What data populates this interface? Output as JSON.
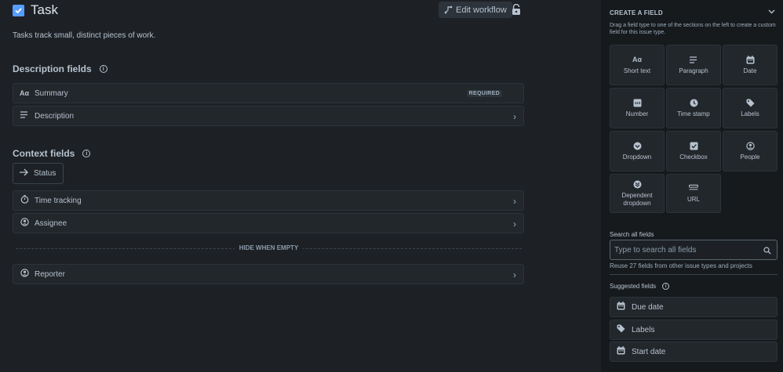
{
  "header": {
    "title": "Task",
    "edit_workflow_label": "Edit workflow",
    "description": "Tasks track small, distinct pieces of work."
  },
  "description_fields": {
    "heading": "Description fields",
    "items": [
      {
        "label": "Summary",
        "icon": "short-text-icon",
        "badge": "REQUIRED"
      },
      {
        "label": "Description",
        "icon": "paragraph-icon"
      }
    ]
  },
  "context_fields": {
    "heading": "Context fields",
    "status_label": "Status",
    "items": [
      {
        "label": "Time tracking",
        "icon": "stopwatch-icon"
      },
      {
        "label": "Assignee",
        "icon": "person-icon"
      }
    ],
    "hide_when_empty_label": "HIDE WHEN EMPTY",
    "hidden_items": [
      {
        "label": "Reporter",
        "icon": "person-icon"
      }
    ]
  },
  "sidebar": {
    "heading": "CREATE A FIELD",
    "description": "Drag a field type to one of the sections on the left to create a custom field for this issue type.",
    "field_types": [
      {
        "label": "Short text",
        "icon": "short-text-icon"
      },
      {
        "label": "Paragraph",
        "icon": "paragraph-icon"
      },
      {
        "label": "Date",
        "icon": "calendar-icon"
      },
      {
        "label": "Number",
        "icon": "number-icon"
      },
      {
        "label": "Time stamp",
        "icon": "clock-icon"
      },
      {
        "label": "Labels",
        "icon": "tag-icon"
      },
      {
        "label": "Dropdown",
        "icon": "dropdown-icon"
      },
      {
        "label": "Checkbox",
        "icon": "checkbox-icon"
      },
      {
        "label": "People",
        "icon": "person-icon"
      },
      {
        "label": "Dependent\ndropdown",
        "icon": "dependent-dropdown-icon"
      },
      {
        "label": "URL",
        "icon": "link-icon"
      }
    ],
    "search": {
      "label": "Search all fields",
      "placeholder": "Type to search all fields",
      "value": "",
      "hint": "Reuse 27 fields from other issue types and projects"
    },
    "suggested_heading": "Suggested fields",
    "suggested": [
      {
        "label": "Due date",
        "icon": "calendar-icon"
      },
      {
        "label": "Labels",
        "icon": "tag-icon"
      },
      {
        "label": "Start date",
        "icon": "calendar-icon"
      }
    ]
  },
  "colors": {
    "background": "#1d2125",
    "sidebar": "#161a1d",
    "accent": "#579dff",
    "text": "#b6c2cf"
  }
}
